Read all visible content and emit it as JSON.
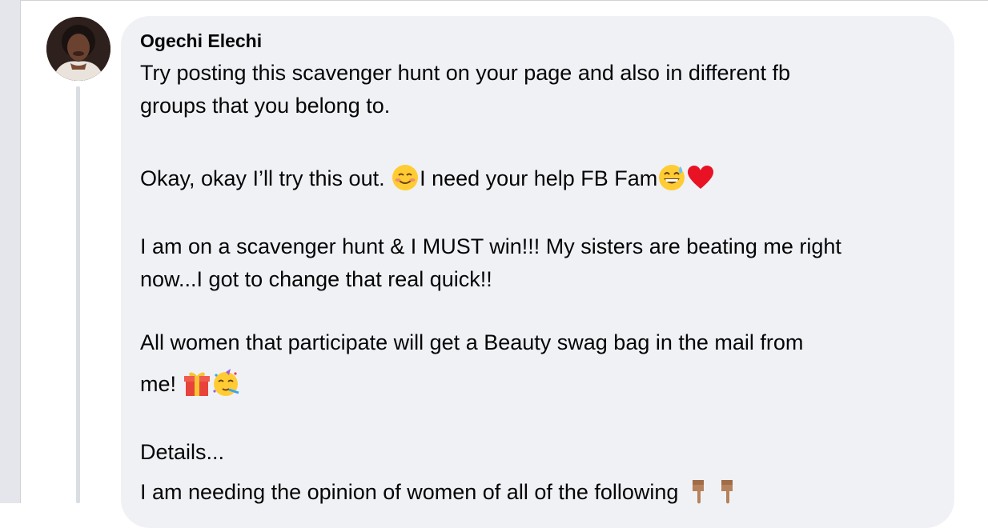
{
  "comment": {
    "author": "Ogechi Elechi",
    "line1": "Try posting this scavenger hunt on your page and also in different fb",
    "line2": "groups that you belong to.",
    "line3a": "Okay, okay I’ll try this out. ",
    "line3b": "I need your help FB Fam",
    "line4": "I am on a scavenger hunt & I MUST win!!! My sisters are beating me right",
    "line5": "now...I got to change that real quick!!",
    "line6": "All women that participate will get a Beauty swag bag in the mail from",
    "line7": "me! ",
    "line8": "Details...",
    "line9": "I am needing the opinion of women of all of the following "
  },
  "colors": {
    "bubble": "#f0f1f5",
    "text": "#050505",
    "gutter": "#e4e6eb",
    "thread_line": "#dadde1"
  },
  "icons": [
    "avatar-photo",
    "smiling-face-icon",
    "grinning-sweat-icon",
    "red-heart-icon",
    "gift-icon",
    "partying-face-icon",
    "pointing-down-icon"
  ]
}
